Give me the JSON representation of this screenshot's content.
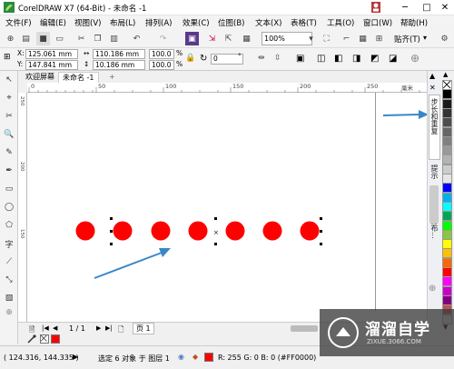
{
  "window": {
    "title": "CorelDRAW X7 (64-Bit) - 未命名 -1",
    "minimize": "─",
    "maximize": "□",
    "close": "✕"
  },
  "menus": [
    "文件(F)",
    "编辑(E)",
    "视图(V)",
    "布局(L)",
    "排列(A)",
    "效果(C)",
    "位图(B)",
    "文本(X)",
    "表格(T)",
    "工具(O)",
    "窗口(W)",
    "帮助(H)"
  ],
  "toolbar": {
    "zoom": "100%",
    "snap_label": "贴齐(T)",
    "snap_arrow": "▾"
  },
  "property_bar": {
    "x_label": "X:",
    "x_value": "125.061 mm",
    "y_label": "Y:",
    "y_value": "147.841 mm",
    "w_value": "110.186 mm",
    "h_value": "10.186 mm",
    "scale_w": "100.0",
    "scale_h": "100.0",
    "pct": "%",
    "rotation": "0",
    "deg": "°"
  },
  "tabs": {
    "welcome": "欢迎屏幕",
    "document": "未命名 -1",
    "add": "+"
  },
  "ruler": {
    "labels": [
      "0",
      "50",
      "100",
      "150",
      "200",
      "250"
    ],
    "unit": "毫米",
    "v_labels": [
      "250",
      "200",
      "150"
    ]
  },
  "page_nav": {
    "counter": "1 / 1",
    "page_tab": "页 1"
  },
  "status": {
    "coords": "( 124.316, 144.335 )",
    "selection": "选定 6 对象 于 图层 1",
    "fill": "R: 255 G: 0 B: 0 (#FF0000)"
  },
  "docker_tabs": [
    "步长和重复",
    "提示",
    "对齐与分布..."
  ],
  "palette": {
    "colors": [
      "#ffffff",
      "#000000",
      "#1a1a1a",
      "#333333",
      "#4d4d4d",
      "#666666",
      "#808080",
      "#999999",
      "#b3b3b3",
      "#cccccc",
      "#e6e6e6",
      "#0000ff",
      "#00b0f0",
      "#00ffff",
      "#00a651",
      "#00ff00",
      "#8cc63f",
      "#ffff00",
      "#ffc000",
      "#ff6600",
      "#ff0000",
      "#ff00ff",
      "#cc00cc",
      "#800080",
      "#c0504d",
      "#f2dcdb"
    ]
  },
  "watermark": {
    "brand": "溜溜自学",
    "url": "ZIXUE.3066.COM"
  },
  "colors": {
    "circle": "#ff0000",
    "arrow": "#3a87c8",
    "accent": "#1f6fbf"
  }
}
